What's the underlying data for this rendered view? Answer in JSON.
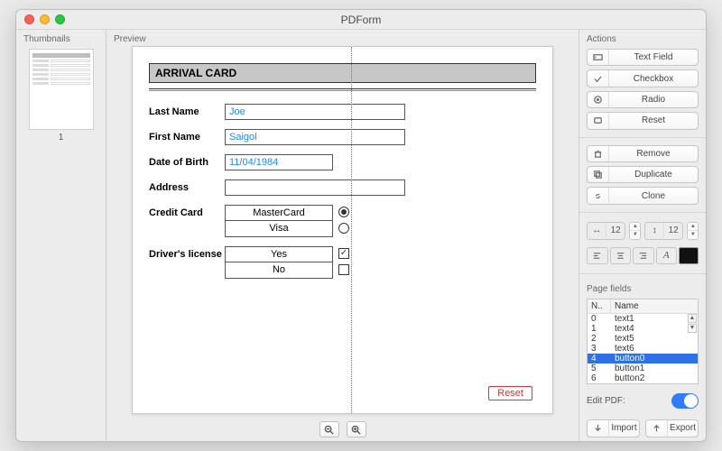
{
  "app": {
    "title": "PDForm"
  },
  "cols": {
    "thumbnails": "Thumbnails",
    "preview": "Preview",
    "actions": "Actions"
  },
  "thumb": {
    "page_num": "1"
  },
  "form": {
    "title": "ARRIVAL CARD",
    "fields": {
      "last_name": {
        "label": "Last Name",
        "value": "Joe"
      },
      "first_name": {
        "label": "First Name",
        "value": "Saigol"
      },
      "dob": {
        "label": "Date of Birth",
        "value": "11/04/1984"
      },
      "address": {
        "label": "Address",
        "value": ""
      },
      "credit_card": {
        "label": "Credit Card",
        "options": [
          "MasterCard",
          "Visa"
        ],
        "selected": 0
      },
      "license": {
        "label": "Driver's license",
        "options": [
          "Yes",
          "No"
        ],
        "selected": 0
      }
    },
    "reset": "Reset"
  },
  "zoom": {
    "in": "zoom-in",
    "out": "zoom-out"
  },
  "actions": {
    "textfield": "Text Field",
    "checkbox": "Checkbox",
    "radio": "Radio",
    "reset_field": "Reset",
    "remove": "Remove",
    "duplicate": "Duplicate",
    "clone": "Clone"
  },
  "size": {
    "w": "12",
    "h": "12"
  },
  "fields_section": "Page fields",
  "fields_table": {
    "cols": [
      "N..",
      "Name"
    ],
    "rows": [
      {
        "n": "0",
        "name": "text1"
      },
      {
        "n": "1",
        "name": "text4"
      },
      {
        "n": "2",
        "name": "text5"
      },
      {
        "n": "3",
        "name": "text6"
      },
      {
        "n": "4",
        "name": "button0"
      },
      {
        "n": "5",
        "name": "button1"
      },
      {
        "n": "6",
        "name": "button2"
      }
    ],
    "selected": 4
  },
  "edit": {
    "label": "Edit PDF:"
  },
  "io": {
    "import": "Import",
    "export": "Export"
  }
}
